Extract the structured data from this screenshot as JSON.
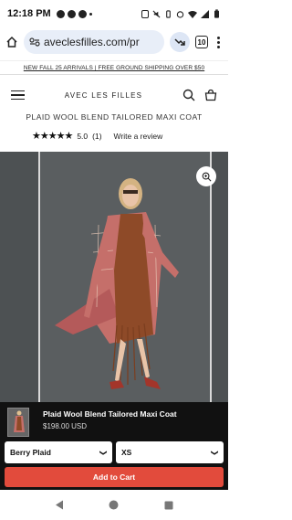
{
  "status_bar": {
    "time": "12:18 PM"
  },
  "browser": {
    "url": "aveclesfilles.com/pr",
    "tab_count": "10"
  },
  "promo": {
    "text": "NEW FALL 25 ARRIVALS | FREE GROUND SHIPPING OVER $50"
  },
  "header": {
    "logo": "AVEC LES FILLES"
  },
  "product": {
    "title": "PLAID WOOL BLEND TAILORED MAXI COAT",
    "stars": "★★★★★",
    "rating": "5.0",
    "review_count": "(1)",
    "write_review": "Write a review"
  },
  "sticky": {
    "name": "Plaid Wool Blend Tailored Maxi Coat",
    "price": "$198.00 USD",
    "color_value": "Berry Plaid",
    "size_value": "XS",
    "add_to_cart": "Add to Cart"
  },
  "colors": {
    "add_to_cart_bg": "#e24b3c",
    "sticky_bg": "#111111",
    "gallery_bg": "#55595b"
  }
}
